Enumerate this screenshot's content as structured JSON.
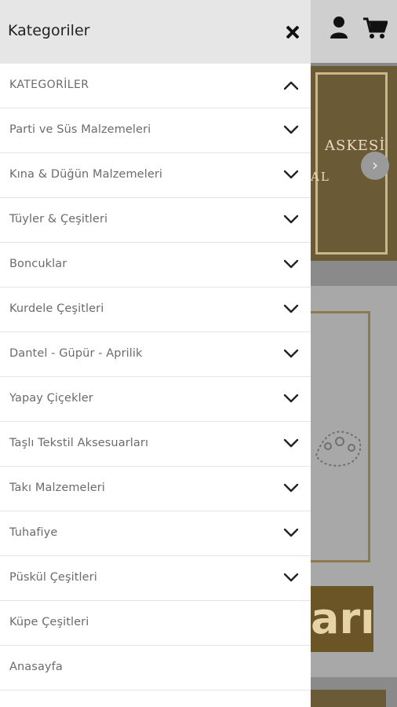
{
  "background": {
    "banner1_line1": "ASKESİ",
    "banner1_line2": "AL",
    "banner2_text": "arı",
    "next_arrow": "›"
  },
  "drawer": {
    "title": "Kategoriler",
    "items": [
      {
        "label": "KATEGORİLER",
        "expanded": true,
        "has_chevron": true
      },
      {
        "label": "Parti ve Süs Malzemeleri",
        "has_chevron": true
      },
      {
        "label": "Kına & Düğün Malzemeleri",
        "has_chevron": true
      },
      {
        "label": "Tüyler & Çeşitleri",
        "has_chevron": true
      },
      {
        "label": "Boncuklar",
        "has_chevron": true
      },
      {
        "label": "Kurdele Çeşitleri",
        "has_chevron": true
      },
      {
        "label": "Dantel - Güpür - Aprilik",
        "has_chevron": true
      },
      {
        "label": "Yapay Çiçekler",
        "has_chevron": true
      },
      {
        "label": "Taşlı Tekstil Aksesuarları",
        "has_chevron": true
      },
      {
        "label": "Takı Malzemeleri",
        "has_chevron": true
      },
      {
        "label": "Tuhafiye",
        "has_chevron": true
      },
      {
        "label": "Püskül Çeşitleri",
        "has_chevron": true
      },
      {
        "label": "Küpe Çeşitleri",
        "has_chevron": false
      },
      {
        "label": "Anasayfa",
        "has_chevron": false
      }
    ]
  },
  "icons": {
    "close": "close-icon",
    "chevron_down": "chevron-down-icon",
    "chevron_up": "chevron-up-icon",
    "user": "user-icon",
    "cart": "cart-icon"
  },
  "colors": {
    "drawer_header_bg": "#e6e6e6",
    "label_color": "#6b6b6b",
    "banner_gold": "#6b5a36"
  }
}
